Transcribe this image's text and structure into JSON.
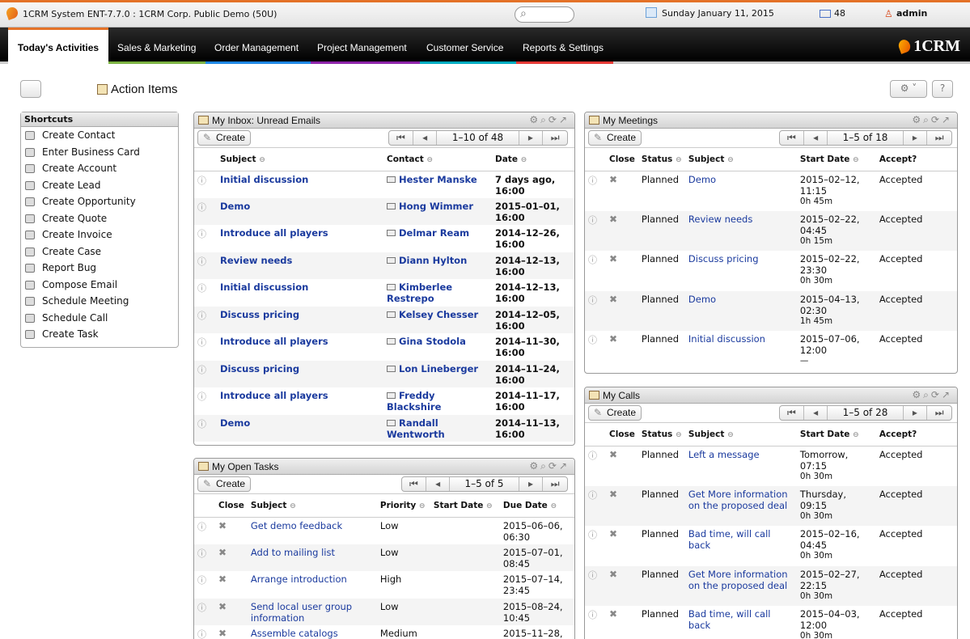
{
  "topbar": {
    "title": "1CRM System ENT-7.7.0 : 1CRM Corp. Public Demo (50U)",
    "date": "Sunday January 11, 2015",
    "mail_count": "48",
    "user": "admin"
  },
  "nav": {
    "tabs": [
      "Today's Activities",
      "Sales & Marketing",
      "Order Management",
      "Project Management",
      "Customer Service",
      "Reports & Settings"
    ],
    "logo": "1CRM"
  },
  "page_title": "Action Items",
  "shortcuts": {
    "title": "Shortcuts",
    "items": [
      "Create Contact",
      "Enter Business Card",
      "Create Account",
      "Create Lead",
      "Create Opportunity",
      "Create Quote",
      "Create Invoice",
      "Create Case",
      "Report Bug",
      "Compose Email",
      "Schedule Meeting",
      "Schedule Call",
      "Create Task"
    ]
  },
  "inbox": {
    "title": "My Inbox: Unread Emails",
    "create": "Create",
    "pager": "1–10 of 48",
    "cols": [
      "Subject",
      "Contact",
      "Date"
    ],
    "rows": [
      [
        "Initial discussion",
        "Hester Manske",
        "7 days ago,",
        "16:00"
      ],
      [
        "Demo",
        "Hong Wimmer",
        "2015–01–01,",
        "16:00"
      ],
      [
        "Introduce all players",
        "Delmar Ream",
        "2014–12–26,",
        "16:00"
      ],
      [
        "Review needs",
        "Diann Hylton",
        "2014–12–13,",
        "16:00"
      ],
      [
        "Initial discussion",
        "Kimberlee Restrepo",
        "2014–12–13,",
        "16:00"
      ],
      [
        "Discuss pricing",
        "Kelsey Chesser",
        "2014–12–05,",
        "16:00"
      ],
      [
        "Introduce all players",
        "Gina Stodola",
        "2014–11–30,",
        "16:00"
      ],
      [
        "Discuss pricing",
        "Lon Lineberger",
        "2014–11–24,",
        "16:00"
      ],
      [
        "Introduce all players",
        "Freddy Blackshire",
        "2014–11–17,",
        "16:00"
      ],
      [
        "Demo",
        "Randall Wentworth",
        "2014–11–13,",
        "16:00"
      ]
    ]
  },
  "tasks": {
    "title": "My Open Tasks",
    "create": "Create",
    "pager": "1–5 of 5",
    "cols": [
      "Close",
      "Subject",
      "Priority",
      "Start Date",
      "Due Date"
    ],
    "rows": [
      [
        "Get demo feedback",
        "Low",
        "2015–06–06,",
        "06:30"
      ],
      [
        "Add to mailing list",
        "Low",
        "2015–07–01,",
        "08:45"
      ],
      [
        "Arrange introduction",
        "High",
        "2015–07–14,",
        "23:45"
      ],
      [
        "Send local user group information",
        "Low",
        "2015–08–24,",
        "10:45"
      ],
      [
        "Assemble catalogs",
        "Medium",
        "2015–11–28,",
        ""
      ]
    ]
  },
  "meetings": {
    "title": "My Meetings",
    "create": "Create",
    "pager": "1–5 of 18",
    "cols": [
      "Close",
      "Status",
      "Subject",
      "Start Date",
      "Accept?"
    ],
    "rows": [
      [
        "Planned",
        "Demo",
        "2015–02–12,",
        "11:15",
        "0h 45m",
        "Accepted"
      ],
      [
        "Planned",
        "Review needs",
        "2015–02–22,",
        "04:45",
        "0h 15m",
        "Accepted"
      ],
      [
        "Planned",
        "Discuss pricing",
        "2015–02–22,",
        "23:30",
        "0h 30m",
        "Accepted"
      ],
      [
        "Planned",
        "Demo",
        "2015–04–13,",
        "02:30",
        "1h 45m",
        "Accepted"
      ],
      [
        "Planned",
        "Initial discussion",
        "2015–07–06,",
        "12:00",
        "—",
        "Accepted"
      ]
    ]
  },
  "calls": {
    "title": "My Calls",
    "create": "Create",
    "pager": "1–5 of 28",
    "cols": [
      "Close",
      "Status",
      "Subject",
      "Start Date",
      "Accept?"
    ],
    "rows": [
      [
        "Planned",
        "Left a message",
        "Tomorrow,",
        "07:15",
        "0h 30m",
        "Accepted"
      ],
      [
        "Planned",
        "Get More information on the proposed deal",
        "Thursday, 09:15",
        "",
        "0h 30m",
        "Accepted"
      ],
      [
        "Planned",
        "Bad time, will call back",
        "2015–02–16,",
        "04:45",
        "0h 30m",
        "Accepted"
      ],
      [
        "Planned",
        "Get More information on the proposed deal",
        "2015–02–27,",
        "22:15",
        "0h 30m",
        "Accepted"
      ],
      [
        "Planned",
        "Bad time, will call back",
        "2015–04–03,",
        "12:00",
        "0h 30m",
        "Accepted"
      ]
    ]
  }
}
